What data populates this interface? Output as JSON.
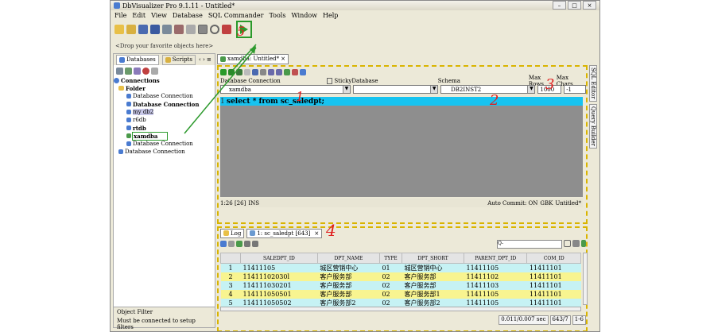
{
  "window": {
    "title": "DbVisualizer Pro 9.1.11 - Untitled*",
    "controls": [
      "–",
      "□",
      "×"
    ]
  },
  "menu": [
    "File",
    "Edit",
    "View",
    "Database",
    "SQL Commander",
    "Tools",
    "Window",
    "Help"
  ],
  "favorites_hint": "<Drop your favorite objects here>",
  "left_tabs": {
    "databases": "Databases",
    "scripts": "Scripts",
    "nav": "‹ › ≡"
  },
  "tree": {
    "connections": "Connections",
    "folder": "Folder",
    "items": [
      "Database Connection",
      "Database Connection",
      "my db2",
      "r6db",
      "rtdb",
      "xamdba",
      "Database Connection"
    ],
    "root_conn": "Database Connection"
  },
  "object_filter": {
    "title": "Object Filter",
    "message": "Must be connected to setup filters"
  },
  "editor_tab": {
    "label": "xamdba: Untitled*",
    "close": "×"
  },
  "conn_bar": {
    "db_conn_label": "Database Connection",
    "sticky_label": "Sticky",
    "database_label": "Database",
    "schema_label": "Schema",
    "maxrows_label": "Max Rows",
    "maxchars_label": "Max Chars",
    "db_conn_value": "xamdba",
    "schema_value": "DB2INST2",
    "maxrows_value": "1000",
    "maxchars_value": "-1"
  },
  "sql": {
    "line_no": "1",
    "text": "select * from sc_saledpt;"
  },
  "editor_status": {
    "pos": "1:26 [26]",
    "mode": "INS",
    "autocommit": "Auto Commit: ON",
    "encoding": "GBK",
    "file": "Untitled*"
  },
  "side_tabs": [
    "SQL Editor",
    "Query Builder"
  ],
  "result_tabs": {
    "log": "Log",
    "result": "1: sc_saledpt [643]",
    "close": "×"
  },
  "filter_placeholder": "Q-",
  "table": {
    "columns": [
      "",
      "SALEDPT_ID",
      "DPT_NAME",
      "TYPE",
      "DPT_SHORT",
      "PARENT_DPT_ID",
      "COM_ID"
    ],
    "rows": [
      [
        "1",
        "11411105",
        "城区营销中心",
        "01",
        "城区营销中心",
        "11411105",
        "11411101"
      ],
      [
        "2",
        "11411102030l",
        "客户服务部",
        "02",
        "客户服务部",
        "11411102",
        "11411101"
      ],
      [
        "3",
        "114111030201",
        "客户服务部",
        "02",
        "客户服务部",
        "11411103",
        "11411101"
      ],
      [
        "4",
        "114111050501",
        "客户服务部",
        "02",
        "客户服务部1",
        "11411105",
        "11411101"
      ],
      [
        "5",
        "114111050502",
        "客户服务部2",
        "02",
        "客户服务部2",
        "11411105",
        "11411101"
      ]
    ]
  },
  "results_status": [
    "0.011/0.007 sec",
    "643/7",
    "1-6"
  ],
  "annotations": [
    "1",
    "2",
    "3",
    "4",
    "5"
  ],
  "colors": {
    "annotation": "#e02020",
    "arrow": "#2e9a2e",
    "sql_highlight": "#17c3f0",
    "dashed_border": "#d9b400"
  }
}
